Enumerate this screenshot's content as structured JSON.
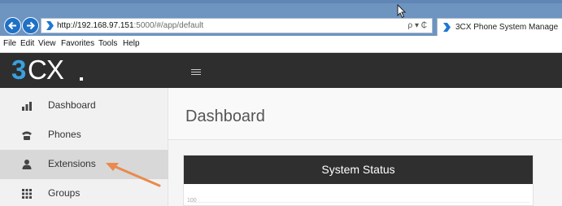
{
  "browser": {
    "url_host": "http://192.168.97.151",
    "url_rest": ":5000/#/app/default",
    "addr_tools": "ρ ▾ ₵",
    "tab_title": "3CX Phone System Manage",
    "menu": [
      "File",
      "Edit",
      "View",
      "Favorites",
      "Tools",
      "Help"
    ]
  },
  "app": {
    "logo_left": "3",
    "logo_right": "CX",
    "sidebar": {
      "items": [
        {
          "label": "Dashboard",
          "icon": "bar-chart-icon",
          "active": false
        },
        {
          "label": "Phones",
          "icon": "phone-icon",
          "active": false
        },
        {
          "label": "Extensions",
          "icon": "user-icon",
          "active": true
        },
        {
          "label": "Groups",
          "icon": "grid-icon",
          "active": false
        }
      ]
    },
    "page_title": "Dashboard",
    "panel": {
      "title": "System Status",
      "y_tick": "100"
    }
  },
  "colors": {
    "ie_frame": "#6e94c0",
    "app_bar": "#2e2e2e",
    "logo_accent": "#3aa0de",
    "sidebar_bg": "#f1f1f1",
    "active_item": "#d8d8d8",
    "annotation_arrow": "#e98a4e"
  }
}
